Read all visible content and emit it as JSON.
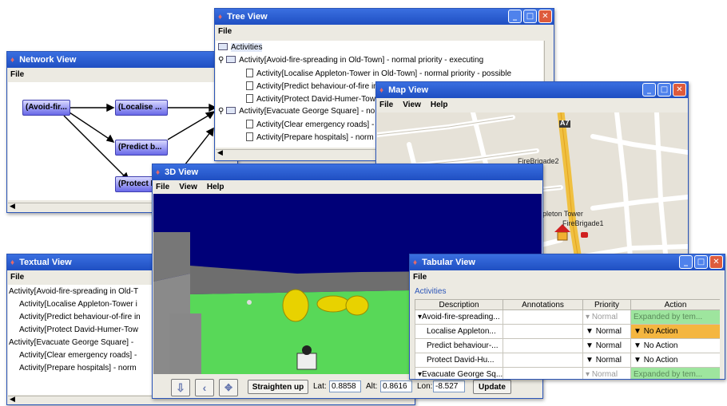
{
  "network": {
    "title": "Network View",
    "menu": [
      "File"
    ],
    "nodes": [
      "(Avoid-fir...",
      "(Localise ...",
      "(Predict b...",
      "(Protect D"
    ]
  },
  "tree": {
    "title": "Tree View",
    "menu": [
      "File"
    ],
    "root": "Activities",
    "items": [
      "Activity[Avoid-fire-spreading in Old-Town] - normal priority - executing",
      "Activity[Localise Appleton-Tower in Old-Town] - normal priority - possible",
      "Activity[Predict behaviour-of-fire in",
      "Activity[Protect David-Humer-Tower",
      "Activity[Evacuate George Square] - no",
      "Activity[Clear emergency roads] -",
      "Activity[Prepare hospitals] - norm"
    ]
  },
  "map": {
    "title": "Map View",
    "menu": [
      "File",
      "View",
      "Help"
    ],
    "labels": [
      "FireBrigade2",
      "Appleton Tower",
      "FireBrigade1",
      "A7",
      "A7"
    ]
  },
  "textual": {
    "title": "Textual View",
    "menu": [
      "File"
    ],
    "lines": [
      "Activity[Avoid-fire-spreading in Old-T",
      "Activity[Localise Appleton-Tower i",
      "Activity[Predict behaviour-of-fire in",
      "Activity[Protect David-Humer-Tow",
      "Activity[Evacuate George Square] -",
      "Activity[Clear emergency roads] -",
      "Activity[Prepare hospitals] - norm"
    ]
  },
  "view3d": {
    "title": "3D View",
    "menu": [
      "File",
      "View",
      "Help"
    ],
    "straighten_label": "Straighten up",
    "lat_label": "Lat:",
    "lat_value": "0.8858",
    "alt_label": "Alt:",
    "alt_value": "0.8616",
    "lon_label": "Lon:",
    "lon_value": "-8.527",
    "update_label": "Update"
  },
  "tabular": {
    "title": "Tabular View",
    "menu": [
      "File"
    ],
    "section": "Activities",
    "columns": [
      "Description",
      "Annotations",
      "Priority",
      "Action"
    ],
    "rows": [
      {
        "desc": "Avoid-fire-spreading...",
        "priority": "Normal",
        "action": "Expanded by tem..."
      },
      {
        "desc": "Localise Appleton...",
        "priority": "Normal",
        "action": "No Action"
      },
      {
        "desc": "Predict behaviour-...",
        "priority": "Normal",
        "action": "No Action"
      },
      {
        "desc": "Protect David-Hu...",
        "priority": "Normal",
        "action": "No Action"
      },
      {
        "desc": "Evacuate George Sq...",
        "priority": "Normal",
        "action": "Expanded by tem..."
      }
    ]
  },
  "colors": {
    "titlebar": "#2557d0",
    "node": "#6868e8",
    "expanded": "#9ee59e",
    "selected_action": "#f4b640",
    "sky": "#000078",
    "ground": "#5ad95a"
  }
}
